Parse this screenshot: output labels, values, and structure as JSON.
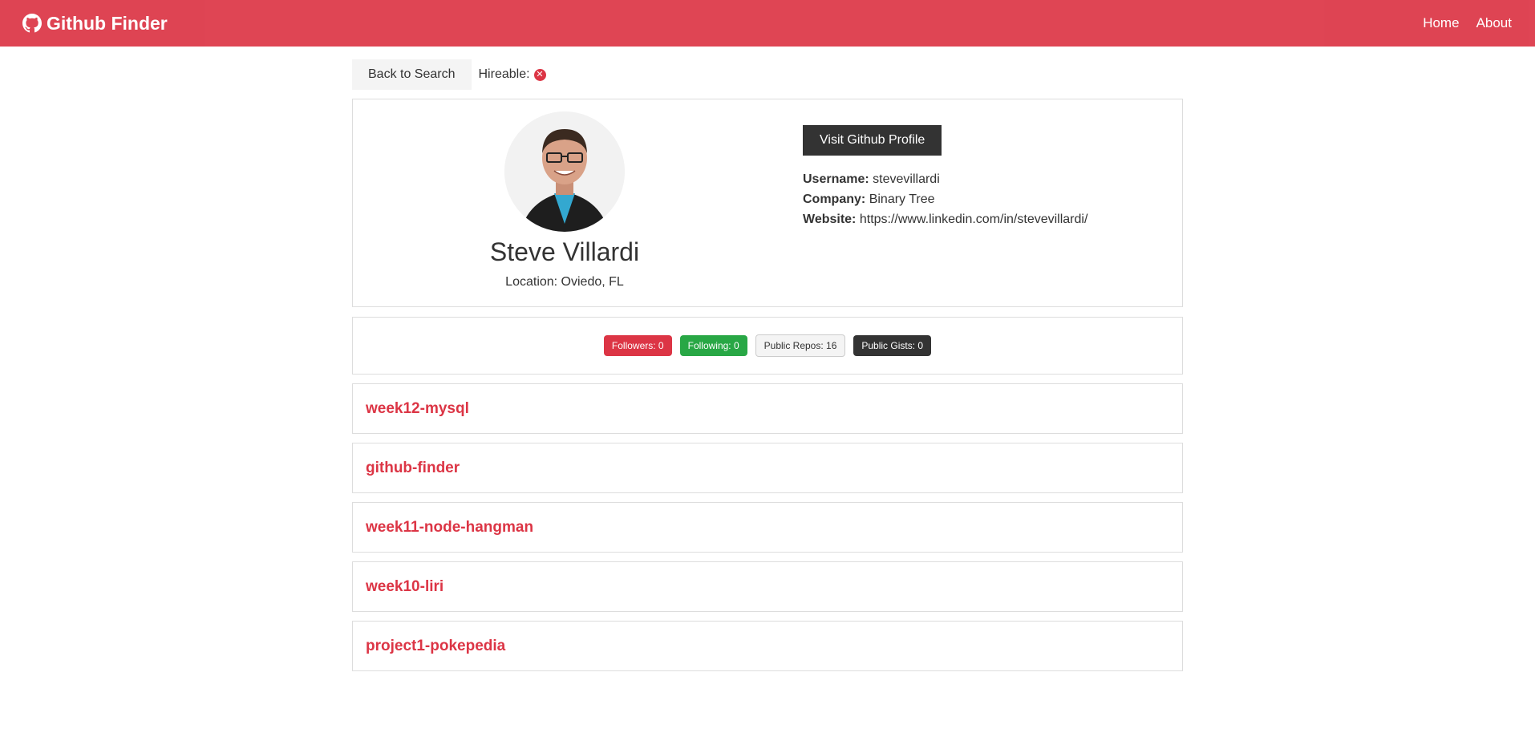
{
  "navbar": {
    "brand": "Github Finder",
    "brand_icon": "github-icon",
    "links": [
      "Home",
      "About"
    ]
  },
  "top": {
    "back_label": "Back to Search",
    "hireable_label": "Hireable:",
    "hireable_icon": "times-circle-icon"
  },
  "profile": {
    "name": "Steve Villardi",
    "location": "Location: Oviedo, FL",
    "visit_label": "Visit Github Profile",
    "username_label": "Username:",
    "username": "stevevillardi",
    "company_label": "Company:",
    "company": "Binary Tree",
    "website_label": "Website:",
    "website": "https://www.linkedin.com/in/stevevillardi/"
  },
  "stats": {
    "followers": "Followers: 0",
    "following": "Following: 0",
    "repos": "Public Repos: 16",
    "gists": "Public Gists: 0"
  },
  "repos": [
    "week12-mysql",
    "github-finder",
    "week11-node-hangman",
    "week10-liri",
    "project1-pokepedia"
  ],
  "colors": {
    "primary": "#dc3545",
    "success": "#28a745",
    "dark": "#333333",
    "light": "#f4f4f4"
  }
}
